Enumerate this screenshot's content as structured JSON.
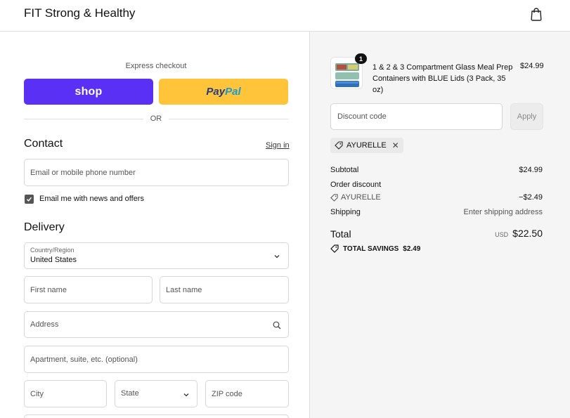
{
  "header": {
    "store_name": "FIT Strong & Healthy",
    "cart_icon": "shopping-bag-icon"
  },
  "express": {
    "label": "Express checkout",
    "shop_label": "shop",
    "paypal_pay": "Pay",
    "paypal_pal": "Pal",
    "or_label": "OR"
  },
  "contact": {
    "title": "Contact",
    "sign_in": "Sign in",
    "email_placeholder": "Email or mobile phone number",
    "newsletter_label": "Email me with news and offers",
    "newsletter_checked": true
  },
  "delivery": {
    "title": "Delivery",
    "country_label": "Country/Region",
    "country_value": "United States",
    "first_name": "First name",
    "last_name": "Last name",
    "address": "Address",
    "apartment": "Apartment, suite, etc. (optional)",
    "city": "City",
    "state": "State",
    "zip": "ZIP code"
  },
  "summary": {
    "product": {
      "name": "1 & 2 & 3 Compartment Glass Meal Prep Containers with BLUE Lids (3 Pack, 35 oz)",
      "price": "$24.99",
      "quantity": "1"
    },
    "discount_placeholder": "Discount code",
    "apply_label": "Apply",
    "applied_code": "AYURELLE",
    "subtotal_label": "Subtotal",
    "subtotal_value": "$24.99",
    "order_discount_label": "Order discount",
    "discount_code": "AYURELLE",
    "discount_value": "−$2.49",
    "shipping_label": "Shipping",
    "shipping_value": "Enter shipping address",
    "total_label": "Total",
    "currency": "USD",
    "total_value": "$22.50",
    "savings_label": "TOTAL SAVINGS",
    "savings_value": "$2.49"
  },
  "colors": {
    "shop_purple": "#5a31f4",
    "paypal_yellow": "#ffc439",
    "summary_bg": "#f5f5f5"
  }
}
